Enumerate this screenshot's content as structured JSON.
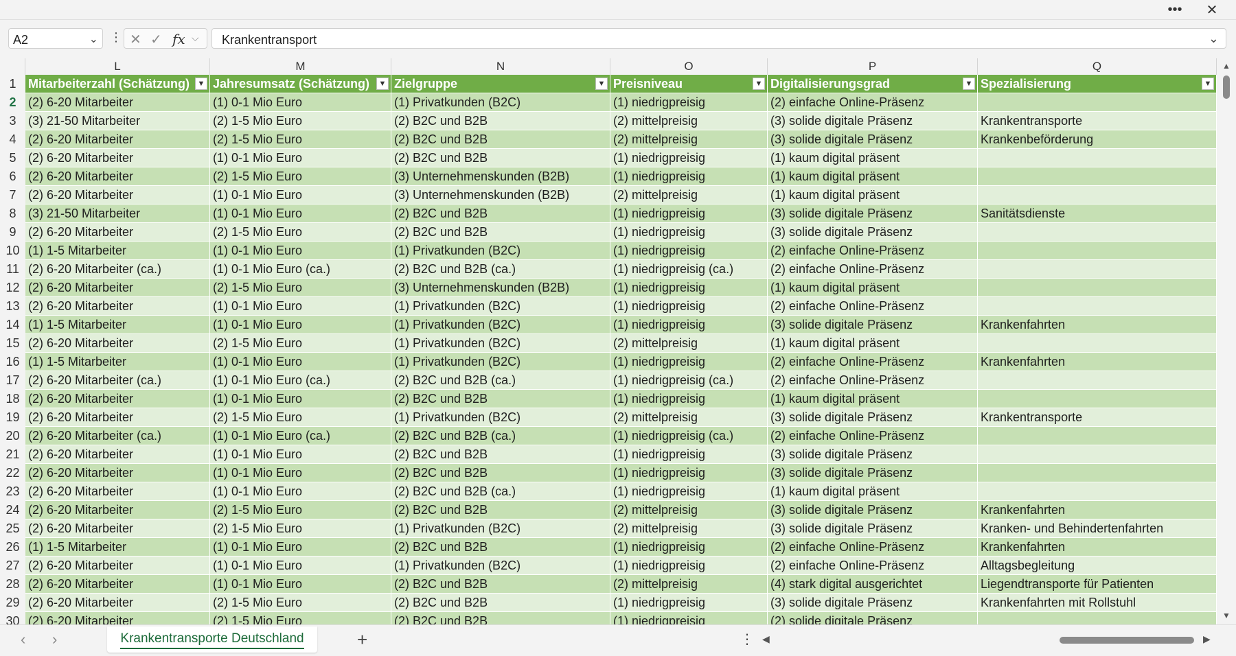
{
  "window": {
    "more_label": "•••",
    "close_label": "✕"
  },
  "formula_bar": {
    "name_box": "A2",
    "name_box_icon": "chevron-down-icon",
    "more_icon": "⋮",
    "cancel_glyph": "✕",
    "enter_glyph": "✓",
    "fx_label": "fx",
    "fx_chevron": "⌵",
    "value": "Krankentransport",
    "expand_icon": "chevron-down-icon"
  },
  "columns": [
    "L",
    "M",
    "N",
    "O",
    "P",
    "Q"
  ],
  "headers": [
    "Mitarbeiterzahl (Schätzung)",
    "Jahresumsatz (Schätzung)",
    "Zielgruppe",
    "Preisniveau",
    "Digitalisierungsgrad",
    "Spezialisierung"
  ],
  "colors": {
    "header_green": "#70ad47",
    "band_dark": "#c6e0b4",
    "band_light": "#e2efda",
    "tab_accent": "#1d6b3a"
  },
  "rows": [
    {
      "n": "2",
      "c": [
        "(2) 6-20 Mitarbeiter",
        "(1) 0-1 Mio Euro",
        "(1) Privatkunden (B2C)",
        "(1) niedrigpreisig",
        "(2) einfache Online-Präsenz",
        ""
      ]
    },
    {
      "n": "3",
      "c": [
        "(3) 21-50 Mitarbeiter",
        "(2) 1-5 Mio Euro",
        "(2) B2C und B2B",
        "(2) mittelpreisig",
        "(3) solide digitale Präsenz",
        "Krankentransporte"
      ]
    },
    {
      "n": "4",
      "c": [
        "(2) 6-20 Mitarbeiter",
        "(2) 1-5 Mio Euro",
        "(2) B2C und B2B",
        "(2) mittelpreisig",
        "(3) solide digitale Präsenz",
        "Krankenbeförderung"
      ]
    },
    {
      "n": "5",
      "c": [
        "(2) 6-20 Mitarbeiter",
        "(1) 0-1 Mio Euro",
        "(2) B2C und B2B",
        "(1) niedrigpreisig",
        "(1) kaum digital präsent",
        ""
      ]
    },
    {
      "n": "6",
      "c": [
        "(2) 6-20 Mitarbeiter",
        "(2) 1-5 Mio Euro",
        "(3) Unternehmenskunden (B2B)",
        "(1) niedrigpreisig",
        "(1) kaum digital präsent",
        ""
      ]
    },
    {
      "n": "7",
      "c": [
        "(2) 6-20 Mitarbeiter",
        "(1) 0-1 Mio Euro",
        "(3) Unternehmenskunden (B2B)",
        "(2) mittelpreisig",
        "(1) kaum digital präsent",
        ""
      ]
    },
    {
      "n": "8",
      "c": [
        "(3) 21-50 Mitarbeiter",
        "(1) 0-1 Mio Euro",
        "(2) B2C und B2B",
        "(1) niedrigpreisig",
        "(3) solide digitale Präsenz",
        "Sanitätsdienste"
      ]
    },
    {
      "n": "9",
      "c": [
        "(2) 6-20 Mitarbeiter",
        "(2) 1-5 Mio Euro",
        "(2) B2C und B2B",
        "(1) niedrigpreisig",
        "(3) solide digitale Präsenz",
        ""
      ]
    },
    {
      "n": "10",
      "c": [
        "(1) 1-5 Mitarbeiter",
        "(1) 0-1 Mio Euro",
        "(1) Privatkunden (B2C)",
        "(1) niedrigpreisig",
        "(2) einfache Online-Präsenz",
        ""
      ]
    },
    {
      "n": "11",
      "c": [
        "(2) 6-20 Mitarbeiter (ca.)",
        "(1) 0-1 Mio Euro (ca.)",
        "(2) B2C und B2B (ca.)",
        "(1) niedrigpreisig (ca.)",
        "(2) einfache Online-Präsenz",
        ""
      ]
    },
    {
      "n": "12",
      "c": [
        "(2) 6-20 Mitarbeiter",
        "(2) 1-5 Mio Euro",
        "(3) Unternehmenskunden (B2B)",
        "(1) niedrigpreisig",
        "(1) kaum digital präsent",
        ""
      ]
    },
    {
      "n": "13",
      "c": [
        "(2) 6-20 Mitarbeiter",
        "(1) 0-1 Mio Euro",
        "(1) Privatkunden (B2C)",
        "(1) niedrigpreisig",
        "(2) einfache Online-Präsenz",
        ""
      ]
    },
    {
      "n": "14",
      "c": [
        "(1) 1-5 Mitarbeiter",
        "(1) 0-1 Mio Euro",
        "(1) Privatkunden (B2C)",
        "(1) niedrigpreisig",
        "(3) solide digitale Präsenz",
        "Krankenfahrten"
      ]
    },
    {
      "n": "15",
      "c": [
        "(2) 6-20 Mitarbeiter",
        "(2) 1-5 Mio Euro",
        "(1) Privatkunden (B2C)",
        "(2) mittelpreisig",
        "(1) kaum digital präsent",
        ""
      ]
    },
    {
      "n": "16",
      "c": [
        "(1) 1-5 Mitarbeiter",
        "(1) 0-1 Mio Euro",
        "(1) Privatkunden (B2C)",
        "(1) niedrigpreisig",
        "(2) einfache Online-Präsenz",
        "Krankenfahrten"
      ]
    },
    {
      "n": "17",
      "c": [
        "(2) 6-20 Mitarbeiter (ca.)",
        "(1) 0-1 Mio Euro (ca.)",
        "(2) B2C und B2B (ca.)",
        "(1) niedrigpreisig (ca.)",
        "(2) einfache Online-Präsenz",
        ""
      ]
    },
    {
      "n": "18",
      "c": [
        "(2) 6-20 Mitarbeiter",
        "(1) 0-1 Mio Euro",
        "(2) B2C und B2B",
        "(1) niedrigpreisig",
        "(1) kaum digital präsent",
        ""
      ]
    },
    {
      "n": "19",
      "c": [
        "(2) 6-20 Mitarbeiter",
        "(2) 1-5 Mio Euro",
        "(1) Privatkunden (B2C)",
        "(2) mittelpreisig",
        "(3) solide digitale Präsenz",
        "Krankentransporte"
      ]
    },
    {
      "n": "20",
      "c": [
        "(2) 6-20 Mitarbeiter (ca.)",
        "(1) 0-1 Mio Euro (ca.)",
        "(2) B2C und B2B (ca.)",
        "(1) niedrigpreisig (ca.)",
        "(2) einfache Online-Präsenz",
        ""
      ]
    },
    {
      "n": "21",
      "c": [
        "(2) 6-20 Mitarbeiter",
        "(1) 0-1 Mio Euro",
        "(2) B2C und B2B",
        "(1) niedrigpreisig",
        "(3) solide digitale Präsenz",
        ""
      ]
    },
    {
      "n": "22",
      "c": [
        "(2) 6-20 Mitarbeiter",
        "(1) 0-1 Mio Euro",
        "(2) B2C und B2B",
        "(1) niedrigpreisig",
        "(3) solide digitale Präsenz",
        ""
      ]
    },
    {
      "n": "23",
      "c": [
        "(2) 6-20 Mitarbeiter",
        "(1) 0-1 Mio Euro",
        "(2) B2C und B2B (ca.)",
        "(1) niedrigpreisig",
        "(1) kaum digital präsent",
        ""
      ]
    },
    {
      "n": "24",
      "c": [
        "(2) 6-20 Mitarbeiter",
        "(2) 1-5 Mio Euro",
        "(2) B2C und B2B",
        "(2) mittelpreisig",
        "(3) solide digitale Präsenz",
        "Krankenfahrten"
      ]
    },
    {
      "n": "25",
      "c": [
        "(2) 6-20 Mitarbeiter",
        "(2) 1-5 Mio Euro",
        "(1) Privatkunden (B2C)",
        "(2) mittelpreisig",
        "(3) solide digitale Präsenz",
        "Kranken- und Behindertenfahrten"
      ]
    },
    {
      "n": "26",
      "c": [
        "(1) 1-5 Mitarbeiter",
        "(1) 0-1 Mio Euro",
        "(2) B2C und B2B",
        "(1) niedrigpreisig",
        "(2) einfache Online-Präsenz",
        "Krankenfahrten"
      ]
    },
    {
      "n": "27",
      "c": [
        "(2) 6-20 Mitarbeiter",
        "(1) 0-1 Mio Euro",
        "(1) Privatkunden (B2C)",
        "(1) niedrigpreisig",
        "(2) einfache Online-Präsenz",
        "Alltagsbegleitung"
      ]
    },
    {
      "n": "28",
      "c": [
        "(2) 6-20 Mitarbeiter",
        "(1) 0-1 Mio Euro",
        "(2) B2C und B2B",
        "(2) mittelpreisig",
        "(4) stark digital ausgerichtet",
        "Liegendtransporte für Patienten"
      ]
    },
    {
      "n": "29",
      "c": [
        "(2) 6-20 Mitarbeiter",
        "(2) 1-5 Mio Euro",
        "(2) B2C und B2B",
        "(1) niedrigpreisig",
        "(3) solide digitale Präsenz",
        "Krankenfahrten mit Rollstuhl"
      ]
    },
    {
      "n": "30",
      "c": [
        "(2) 6-20 Mitarbeiter",
        "(2) 1-5 Mio Euro",
        "(2) B2C und B2B",
        "(1) niedrigpreisig",
        "(2) solide digitale Präsenz",
        ""
      ]
    }
  ],
  "sheet_tabs": {
    "active": "Krankentransporte Deutschland",
    "add_label": "+"
  },
  "nav": {
    "prev": "‹",
    "next": "›",
    "more": "⋮"
  }
}
